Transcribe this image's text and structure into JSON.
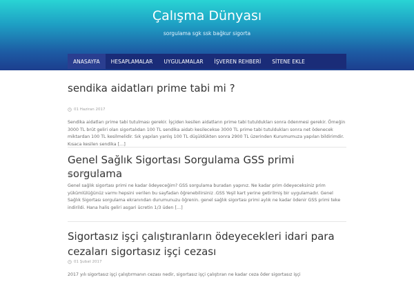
{
  "header": {
    "title": "Çalışma Dünyası",
    "description": "sorgulama sgk ssk bağkur sigorta"
  },
  "nav": {
    "items": [
      {
        "label": "ANASAYFA"
      },
      {
        "label": "HESAPLAMALAR"
      },
      {
        "label": "UYGULAMALAR"
      },
      {
        "label": "İŞVEREN REHBERİ"
      },
      {
        "label": "SİTENE EKLE"
      }
    ]
  },
  "posts": [
    {
      "title": "sendika aidatları prime tabi mi ?",
      "date": "01 Haziran 2017",
      "excerpt": "Sendika aidatları prime tabi tutulması gerekir. İşçiden kesilen aidatların prime tabi tutuldukları sonra ödenmesi gerekir. Örneğin 3000 TL brüt geliri olan sigortalıdan 100 TL sendika aidatı kesilecekse 3000 TL prime tabi tutuldukları sonra net ödenecek miktardan 100 TL kesilmelidir. Sık yapılan yanlış 100 TL düşüldükten sonra 2900 TL üzerinden Kurumumuza yapılan bildirimdir. Kısaca kesilen sendika",
      "read_more": "[…]"
    },
    {
      "title": "Genel Sağlık Sigortası Sorgulama GSS primi sorgulama",
      "date": "18 Mart 2017",
      "excerpt": "Genel sağlık sigortası primi ne kadar ödeyeceğim?   GSS sorgulama  buradan yapınız. Ne kadar prim ödeyeceksiniz prim yükümlülüğünüz varmı hepsini verilen bu sayfadan öğrenebilirsiniz .GSS Yeşil kart yerine getirilmiş bir uygulamadır. Genel Sağlık Sigortası sorgulama ekranından durumunuzu öğrenin. genel sağlık sigortası primi aylık ne kadar ödenir GSS primi teke indirildi. Hana halis geliri asgari ücretin 1/3 üden",
      "read_more": "[…]"
    },
    {
      "title": "Sigortasız işçi çalıştıranların ödeyecekleri idari para cezaları sigortasız işçi cezası",
      "date": "01 Şubat 2017",
      "excerpt": "2017 yılı sigortasız işçi çalıştırmanın cezası nedir, sigortasız işçi çalıştıran ne kadar ceza öder sigortasız işçi",
      "read_more": ""
    }
  ],
  "colors": {
    "header_top": "#29d4d4",
    "header_bottom": "#1c3e8e",
    "nav_bg": "#1a2c78",
    "nav_active": "#2a3e90"
  },
  "icons": {
    "date": "clock-icon"
  }
}
